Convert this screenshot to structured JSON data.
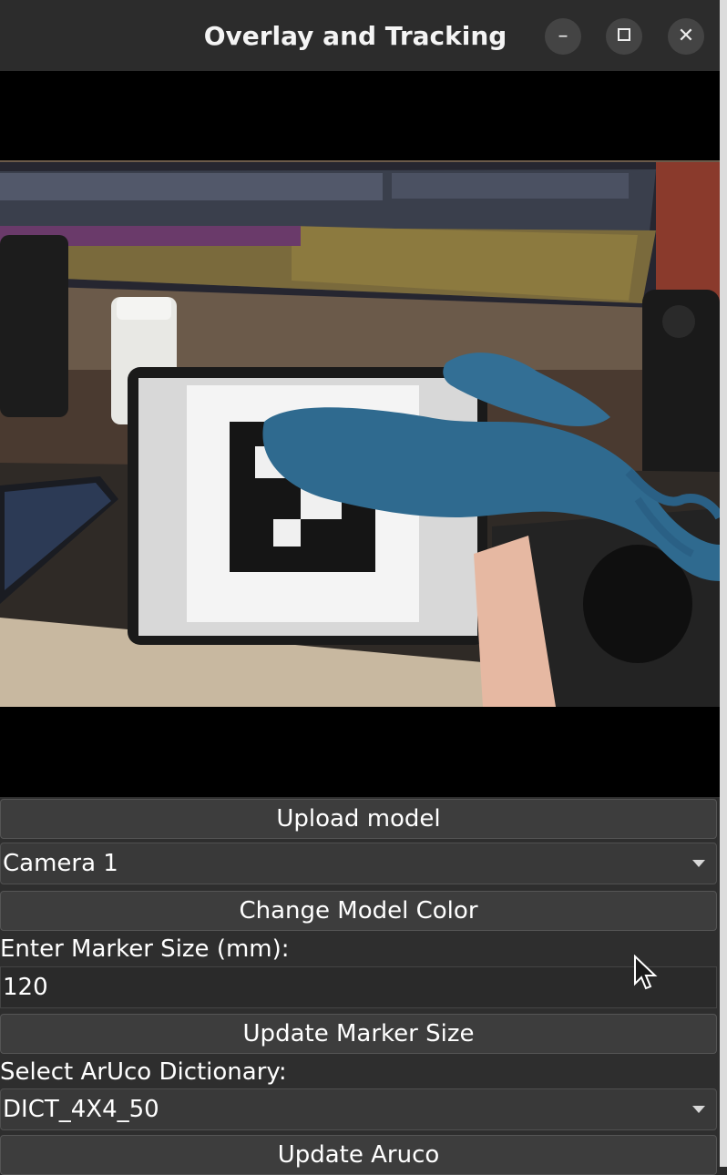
{
  "window": {
    "title": "Overlay and Tracking",
    "minimize_icon": "minimize-icon",
    "maximize_icon": "maximize-icon",
    "close_icon": "close-icon"
  },
  "video": {
    "description_icon": "camera-feed"
  },
  "controls": {
    "upload_label": "Upload model",
    "camera_select": "Camera 1",
    "change_color_label": "Change Model Color",
    "marker_size_label": "Enter Marker Size (mm):",
    "marker_size_value": "120",
    "update_marker_label": "Update Marker Size",
    "aruco_label": "Select ArUco Dictionary:",
    "aruco_select": "DICT_4X4_50",
    "update_aruco_label": "Update Aruco"
  },
  "colors": {
    "model_blue": "#2f6a8f",
    "background": "#2e2e2e"
  }
}
